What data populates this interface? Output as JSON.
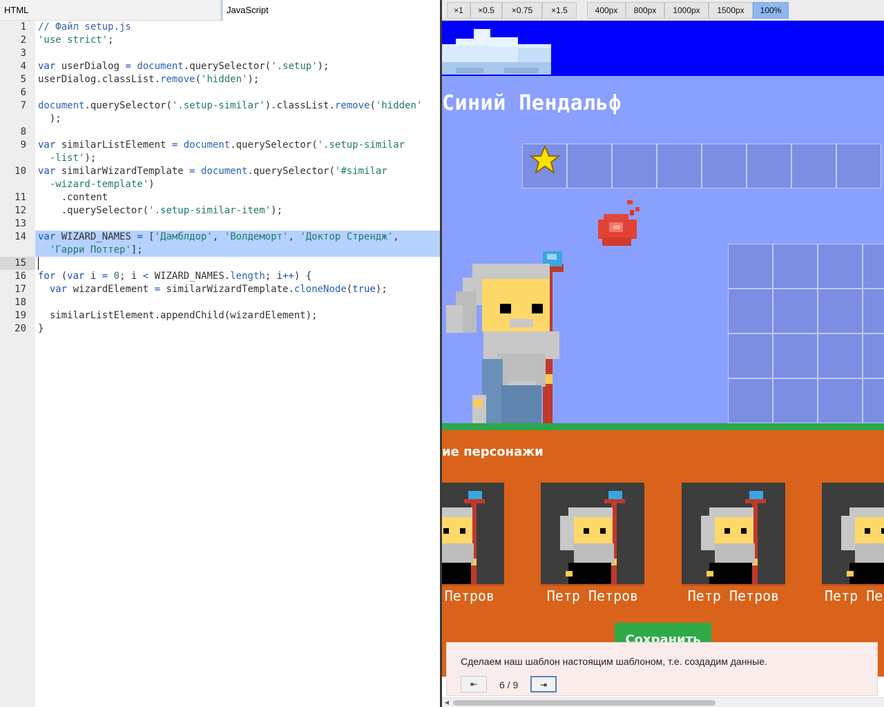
{
  "editor": {
    "tabs": [
      "HTML",
      "JavaScript"
    ],
    "active_tab": "JavaScript",
    "line_numbers": [
      "1",
      "2",
      "3",
      "4",
      "5",
      "6",
      "7",
      "",
      "8",
      "9",
      "",
      "10",
      "",
      "11",
      "12",
      "13",
      "14",
      "",
      "15",
      "16",
      "17",
      "18",
      "19",
      "20"
    ],
    "selected_lines": [
      14
    ],
    "cursor_line": 15
  },
  "preview": {
    "scale_buttons": [
      "×1",
      "×0.5",
      "×0.75",
      "×1.5"
    ],
    "width_buttons": [
      "400px",
      "800px",
      "1000px",
      "1500px",
      "100%"
    ],
    "active_width": "100%",
    "wizard_name": "Синий Пендальф",
    "similar_title": "ие персонажи",
    "similar_names": [
      "Петров",
      "Петр Петров",
      "Петр Петров",
      "Петр Пе"
    ],
    "save_label": "Сохранить"
  },
  "tour": {
    "text": "Сделаем наш шаблон настоящим шаблоном, т.е. создадим данные.",
    "counter": "6 / 9",
    "prev_icon": "⇤",
    "next_icon": "⇥"
  },
  "colors": {
    "sky": "#0000ff",
    "stage": "#8aa0ff",
    "ground": "#d9631a",
    "selection": "#b5d1ff",
    "save": "#2daa46"
  }
}
